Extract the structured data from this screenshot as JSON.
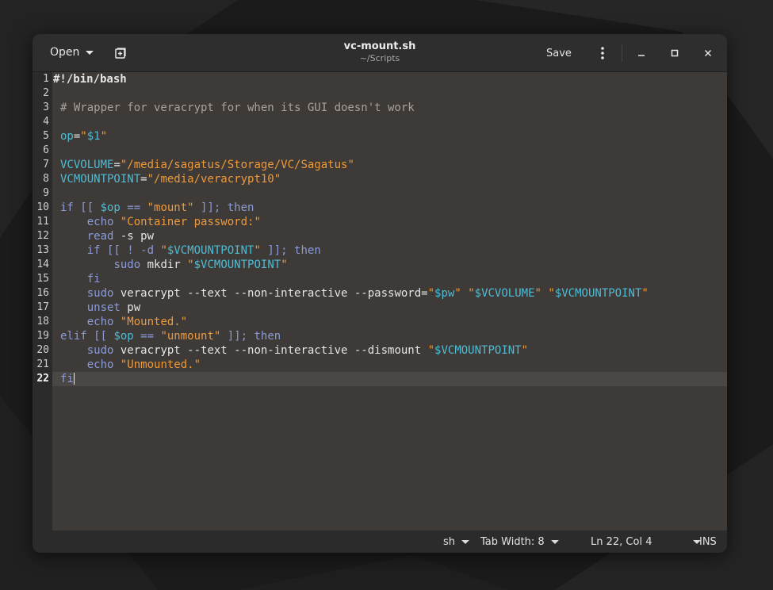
{
  "window": {
    "title": "vc-mount.sh",
    "subtitle": "~/Scripts"
  },
  "headerbar": {
    "open_label": "Open",
    "new_tab_icon": "new-tab-icon",
    "save_label": "Save",
    "menu_icon": "kebab-menu-icon",
    "minimize_icon": "minimize-icon",
    "maximize_icon": "maximize-icon",
    "close_icon": "close-icon"
  },
  "colors": {
    "comment": "#a8a29a",
    "keyword": "#8c9bd8",
    "string": "#ef9a3a",
    "variable": "#4fbcd4",
    "text": "#e6e6e6"
  },
  "editor": {
    "line_numbers": [
      "1",
      "2",
      "3",
      "4",
      "5",
      "6",
      "7",
      "8",
      "9",
      "10",
      "11",
      "12",
      "13",
      "14",
      "15",
      "16",
      "17",
      "18",
      "19",
      "20",
      "21",
      "22"
    ],
    "current_line": "22",
    "lines": [
      [
        [
          "t",
          "#!/bin/bash"
        ]
      ],
      [],
      [
        [
          "c",
          "# Wrapper for veracrypt for when its GUI doesn't work"
        ]
      ],
      [],
      [
        [
          "v",
          "op"
        ],
        [
          "t",
          "="
        ],
        [
          "s",
          "\""
        ],
        [
          "v",
          "$1"
        ],
        [
          "s",
          "\""
        ]
      ],
      [],
      [
        [
          "v",
          "VCVOLUME"
        ],
        [
          "t",
          "="
        ],
        [
          "s",
          "\"/media/sagatus/Storage/VC/Sagatus\""
        ]
      ],
      [
        [
          "v",
          "VCMOUNTPOINT"
        ],
        [
          "t",
          "="
        ],
        [
          "s",
          "\"/media/veracrypt10\""
        ]
      ],
      [],
      [
        [
          "k",
          "if [[ "
        ],
        [
          "v",
          "$op"
        ],
        [
          "k",
          " == "
        ],
        [
          "s",
          "\"mount\""
        ],
        [
          "k",
          " ]]; then"
        ]
      ],
      [
        [
          "t",
          "    "
        ],
        [
          "k",
          "echo"
        ],
        [
          "t",
          " "
        ],
        [
          "s",
          "\"Container password:\""
        ]
      ],
      [
        [
          "t",
          "    "
        ],
        [
          "k",
          "read"
        ],
        [
          "t",
          " -s pw"
        ]
      ],
      [
        [
          "t",
          "    "
        ],
        [
          "k",
          "if [[ ! -d "
        ],
        [
          "s",
          "\""
        ],
        [
          "v",
          "$VCMOUNTPOINT"
        ],
        [
          "s",
          "\""
        ],
        [
          "k",
          " ]]; then"
        ]
      ],
      [
        [
          "t",
          "        "
        ],
        [
          "k",
          "sudo"
        ],
        [
          "t",
          " mkdir "
        ],
        [
          "s",
          "\""
        ],
        [
          "v",
          "$VCMOUNTPOINT"
        ],
        [
          "s",
          "\""
        ]
      ],
      [
        [
          "t",
          "    "
        ],
        [
          "k",
          "fi"
        ]
      ],
      [
        [
          "t",
          "    "
        ],
        [
          "k",
          "sudo"
        ],
        [
          "t",
          " veracrypt --text --non-interactive --password="
        ],
        [
          "s",
          "\""
        ],
        [
          "v",
          "$pw"
        ],
        [
          "s",
          "\""
        ],
        [
          "t",
          " "
        ],
        [
          "s",
          "\""
        ],
        [
          "v",
          "$VCVOLUME"
        ],
        [
          "s",
          "\""
        ],
        [
          "t",
          " "
        ],
        [
          "s",
          "\""
        ],
        [
          "v",
          "$VCMOUNTPOINT"
        ],
        [
          "s",
          "\""
        ]
      ],
      [
        [
          "t",
          "    "
        ],
        [
          "k",
          "unset"
        ],
        [
          "t",
          " pw"
        ]
      ],
      [
        [
          "t",
          "    "
        ],
        [
          "k",
          "echo"
        ],
        [
          "t",
          " "
        ],
        [
          "s",
          "\"Mounted.\""
        ]
      ],
      [
        [
          "k",
          "elif [[ "
        ],
        [
          "v",
          "$op"
        ],
        [
          "k",
          " == "
        ],
        [
          "s",
          "\"unmount\""
        ],
        [
          "k",
          " ]]; then"
        ]
      ],
      [
        [
          "t",
          "    "
        ],
        [
          "k",
          "sudo"
        ],
        [
          "t",
          " veracrypt --text --non-interactive --dismount "
        ],
        [
          "s",
          "\""
        ],
        [
          "v",
          "$VCMOUNTPOINT"
        ],
        [
          "s",
          "\""
        ]
      ],
      [
        [
          "t",
          "    "
        ],
        [
          "k",
          "echo"
        ],
        [
          "t",
          " "
        ],
        [
          "s",
          "\"Unmounted.\""
        ]
      ],
      [
        [
          "k",
          "fi"
        ]
      ]
    ]
  },
  "statusbar": {
    "language": "sh",
    "tab_width": "Tab Width: 8",
    "position": "Ln 22, Col 4",
    "mode": "INS"
  }
}
